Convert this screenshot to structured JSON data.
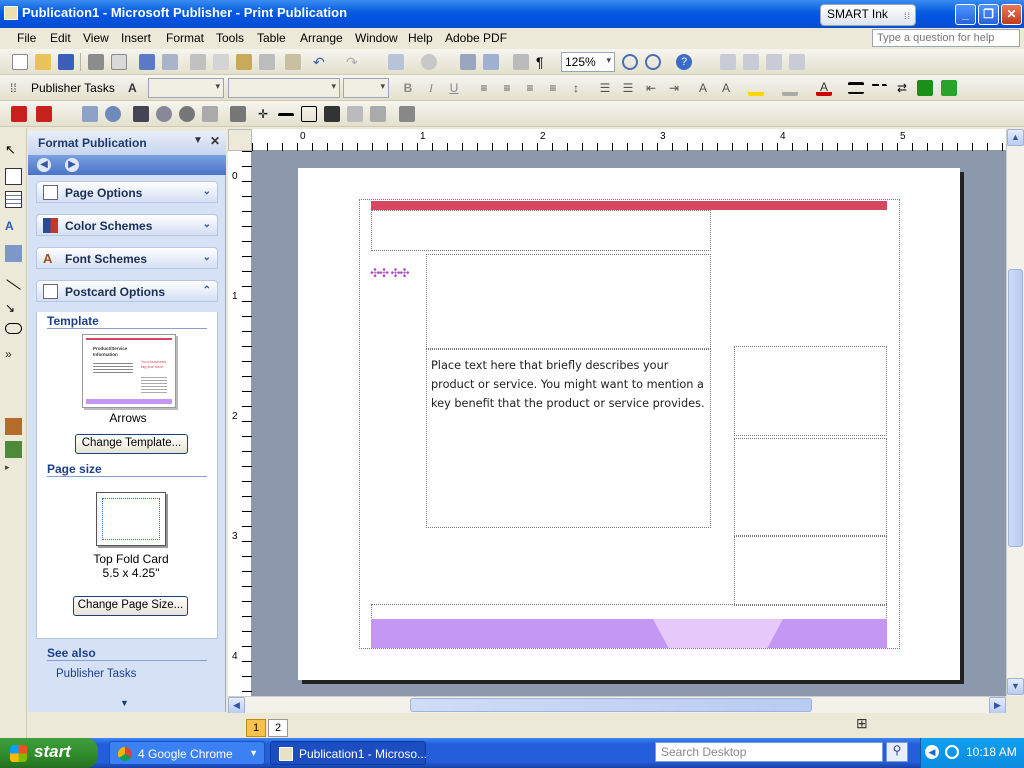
{
  "window": {
    "title": "Publication1 - Microsoft Publisher - Print Publication"
  },
  "smart_ink": {
    "label": "SMART Ink"
  },
  "menu": {
    "items": [
      "File",
      "Edit",
      "View",
      "Insert",
      "Format",
      "Tools",
      "Table",
      "Arrange",
      "Window",
      "Help",
      "Adobe PDF"
    ],
    "help_placeholder": "Type a question for help"
  },
  "standard_toolbar": {
    "zoom": "125%"
  },
  "format_toolbar": {
    "publisher_tasks": "Publisher Tasks"
  },
  "task_pane": {
    "title": "Format Publication",
    "sections": [
      "Page Options",
      "Color Schemes",
      "Font Schemes",
      "Postcard Options"
    ],
    "template_label": "Template",
    "template_name": "Arrows",
    "change_template_button": "Change Template...",
    "page_size_label": "Page size",
    "page_size_name": "Top Fold Card",
    "page_size_dims": "5.5 x 4.25\"",
    "change_page_size_button": "Change Page Size...",
    "see_also_label": "See also",
    "see_also_link": "Publisher Tasks"
  },
  "thumbnail": {
    "line1": "Product/Service",
    "line2": "Information",
    "side": "Your business tag line here."
  },
  "rulers": {
    "horizontal": [
      "0",
      "1",
      "2",
      "3",
      "4",
      "5"
    ],
    "vertical": [
      "0",
      "1",
      "2",
      "3",
      "4"
    ]
  },
  "document": {
    "body_text": "Place text here that briefly describes your product or service. You might want to mention a key benefit that the product or service provides."
  },
  "page_nav": {
    "pages": [
      "1",
      "2"
    ]
  },
  "taskbar": {
    "start_label": "start",
    "tasks": [
      "4 Google Chrome",
      "Publication1 - Microso..."
    ],
    "search_placeholder": "Search Desktop",
    "clock": "10:18 AM"
  },
  "colors": {
    "title_bar": "#0054e3",
    "top_band": "#d8475f",
    "bottom_band": "#c597f4",
    "bottom_tab": "#e6c8fa",
    "accent_marks": "#b14cc9"
  }
}
